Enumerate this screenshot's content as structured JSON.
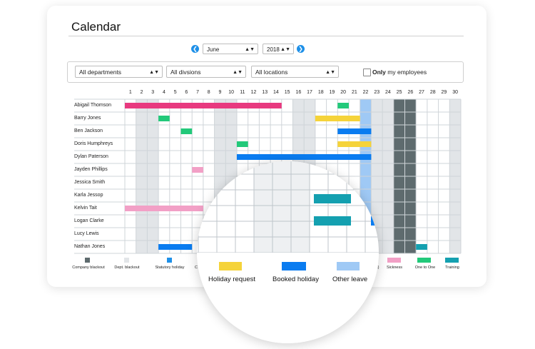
{
  "title": "Calendar",
  "header": {
    "month": "June",
    "year": "2018"
  },
  "filters": {
    "department": "All departments",
    "division": "All divsions",
    "location": "All locations",
    "only_label": "Only",
    "my_employees_label": "my employees"
  },
  "days": [
    "1",
    "2",
    "3",
    "4",
    "5",
    "6",
    "7",
    "8",
    "9",
    "10",
    "11",
    "12",
    "13",
    "14",
    "15",
    "16",
    "17",
    "18",
    "19",
    "20",
    "21",
    "22",
    "23",
    "24",
    "25",
    "26",
    "27",
    "28",
    "29",
    "30"
  ],
  "employees": [
    "Abigail Thomson",
    "Barry Jones",
    "Ben Jackson",
    "Doris Humphreys",
    "Dylan Paterson",
    "Jayden Phillips",
    "Jessica Smith",
    "Karla Jessop",
    "Kelvin Tait",
    "Logan Clarke",
    "Lucy Lewis",
    "Nathan Jones"
  ],
  "colors": {
    "company_blackout": "#5e6b6e",
    "dept_blackout": "#e2e5e8",
    "statutory_holiday": "#1e90e8",
    "holiday_request": "#f5d33a",
    "booked_holiday": "#0a7cf0",
    "other_leave": "#9fc9f5",
    "sickness": "#f2a0c6",
    "one_to_one": "#22c97a",
    "training": "#14a0b0",
    "pink_bar": "#e8397f"
  },
  "legend_small": {
    "company_blackout": "Company blackout",
    "dept_blackout": "Dept. blackout",
    "statutory_holiday": "Statutory holiday",
    "partial_c": "C",
    "partial_n": "n)",
    "sickness": "Sickness",
    "one_to_one": "One to One",
    "training": "Training"
  },
  "legend_lens": {
    "holiday_request": "Holiday request",
    "booked_holiday": "Booked holiday",
    "other_leave": "Other leave"
  }
}
